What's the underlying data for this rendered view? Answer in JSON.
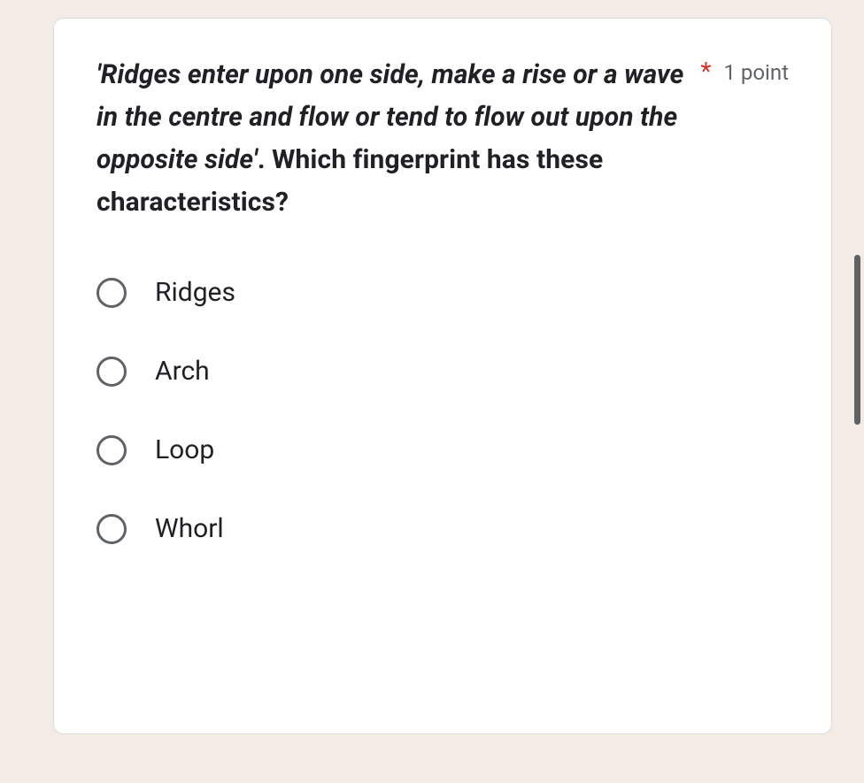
{
  "question": {
    "italic_text": "'Ridges enter upon one side, make a rise or a wave in the centre and flow or tend to flow out upon the opposite side'",
    "plain_text": ". Which fingerprint has these characteristics?",
    "required_marker": "*",
    "points_label": "1 point"
  },
  "options": [
    {
      "label": "Ridges"
    },
    {
      "label": "Arch"
    },
    {
      "label": "Loop"
    },
    {
      "label": "Whorl"
    }
  ]
}
